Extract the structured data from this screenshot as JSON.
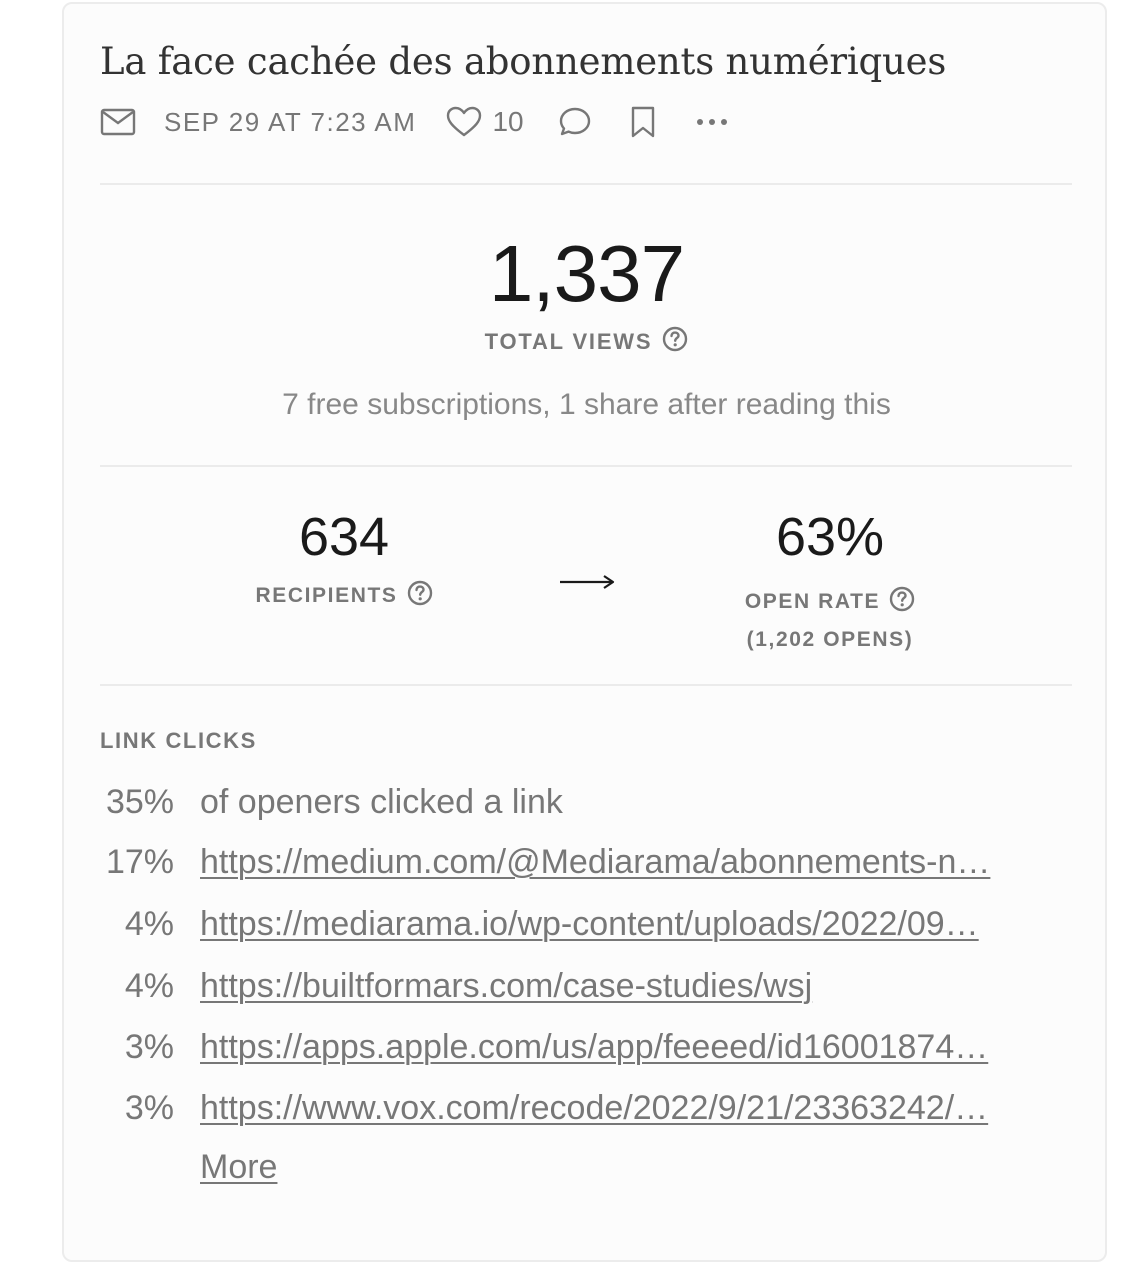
{
  "post": {
    "title": "La face cachée des abonnements numériques",
    "date": "SEP 29 AT 7:23 AM",
    "likes": "10"
  },
  "icons": {
    "mail": "envelope-icon",
    "like": "heart-icon",
    "comment": "speech-bubble-icon",
    "bookmark": "bookmark-icon",
    "more": "ellipsis-icon",
    "help": "question-circle-icon",
    "arrow": "right-arrow-icon"
  },
  "views": {
    "total": "1,337",
    "label": "TOTAL VIEWS",
    "summary": "7 free subscriptions, 1 share after reading this"
  },
  "email": {
    "recipients": "634",
    "recipients_label": "RECIPIENTS",
    "open_rate": "63%",
    "open_rate_label": "OPEN RATE",
    "opens": "(1,202 OPENS)"
  },
  "link_clicks": {
    "header": "LINK CLICKS",
    "summary_pct": "35%",
    "summary_text": "of openers clicked a link",
    "links": [
      {
        "pct": "17%",
        "url": "https://medium.com/@Mediarama/abonnements-n…"
      },
      {
        "pct": "4%",
        "url": "https://mediarama.io/wp-content/uploads/2022/09…"
      },
      {
        "pct": "4%",
        "url": "https://builtformars.com/case-studies/wsj"
      },
      {
        "pct": "3%",
        "url": "https://apps.apple.com/us/app/feeeed/id16001874…"
      },
      {
        "pct": "3%",
        "url": "https://www.vox.com/recode/2022/9/21/23363242/…"
      }
    ],
    "more_label": "More"
  },
  "colors": {
    "text_primary": "#1a1a1a",
    "text_muted": "#777777",
    "divider": "#ebebeb",
    "card_border": "#ececec"
  }
}
